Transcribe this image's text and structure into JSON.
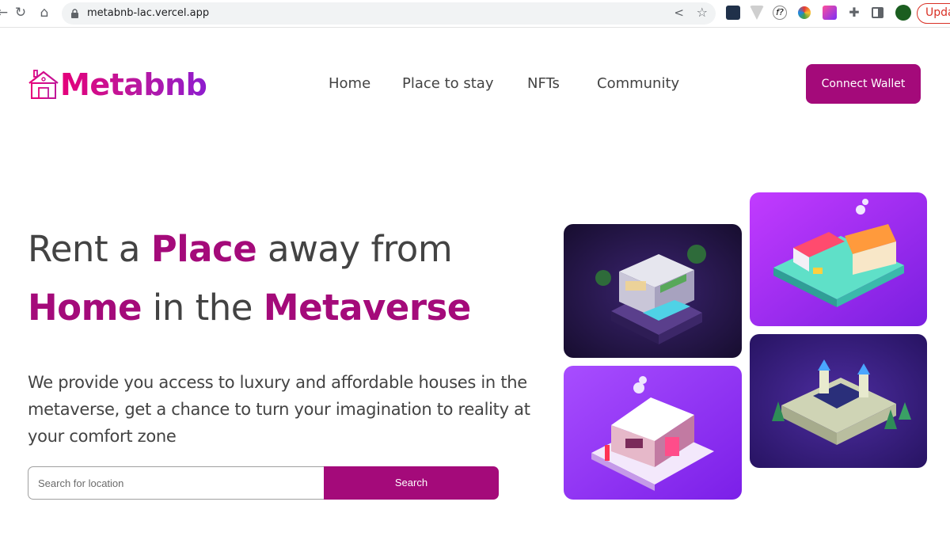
{
  "browser": {
    "url": "metabnb-lac.vercel.app",
    "update_label": "Upda"
  },
  "header": {
    "logo_text": "Metabnb",
    "nav": [
      {
        "label": "Home"
      },
      {
        "label": "Place to stay"
      },
      {
        "label": "NFTs"
      },
      {
        "label": "Community"
      }
    ],
    "connect_label": "Connect Wallet"
  },
  "hero": {
    "line1": {
      "a": "Rent a ",
      "b": "Place",
      "c": " away from"
    },
    "line2": {
      "a": "Home",
      "b": " in the ",
      "c": "Metaverse"
    },
    "subtitle": "We provide you access to luxury and affordable houses in the metaverse, get a chance to turn your imagination to reality at your comfort zone",
    "search_placeholder": "Search for location",
    "search_label": "Search"
  },
  "colors": {
    "brand": "#a40a7a",
    "text": "#434343"
  },
  "gallery": [
    {
      "name": "villa-image"
    },
    {
      "name": "market-stalls-image"
    },
    {
      "name": "snow-cottage-image"
    },
    {
      "name": "castle-image"
    }
  ]
}
